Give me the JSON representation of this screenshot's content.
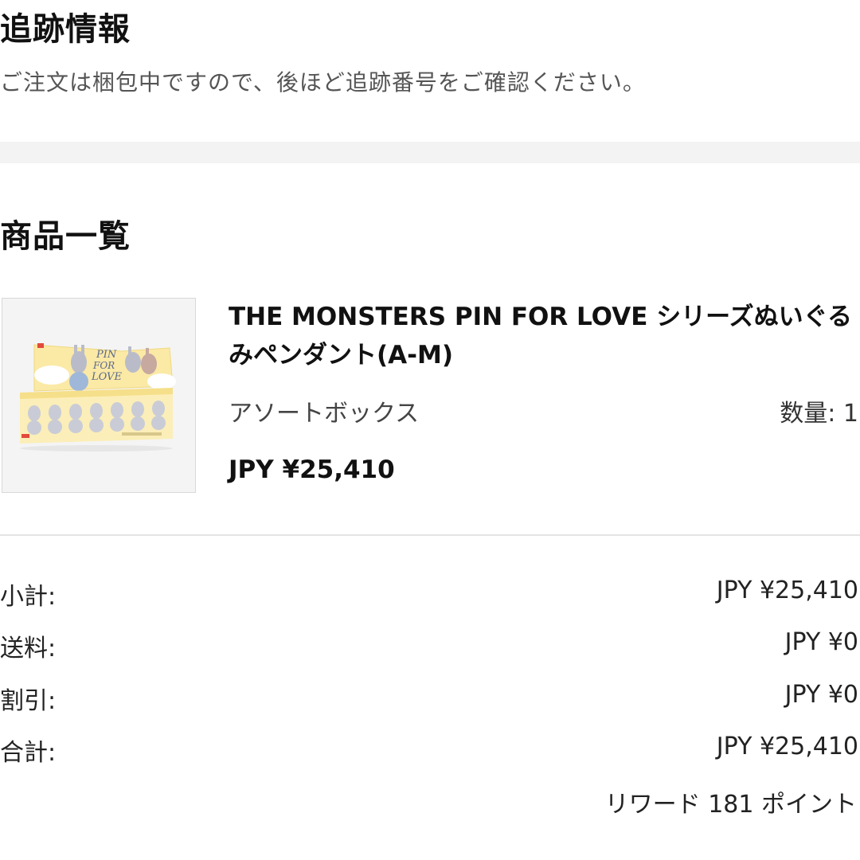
{
  "tracking": {
    "title": "追跡情報",
    "message": "ご注文は梱包中ですので、後ほど追跡番号をご確認ください。"
  },
  "items": {
    "title": "商品一覧",
    "product": {
      "name": "THE MONSTERS PIN FOR LOVE シリーズぬいぐるみペンダント(A-M)",
      "variant": "アソートボックス",
      "quantity": "数量: 1",
      "price": "JPY ¥25,410",
      "image": {
        "box_text": "PIN FOR LOVE",
        "colors": {
          "box": "#fbe9a6",
          "figure": "#c9ccd6",
          "accent": "#e24a3b"
        }
      }
    }
  },
  "summary": {
    "subtotal_label": "小計:",
    "subtotal_value": "JPY ¥25,410",
    "shipping_label": "送料:",
    "shipping_value": "JPY ¥0",
    "discount_label": "割引:",
    "discount_value": "JPY ¥0",
    "total_label": "合計:",
    "total_value": "JPY ¥25,410",
    "reward": "リワード 181 ポイント"
  }
}
